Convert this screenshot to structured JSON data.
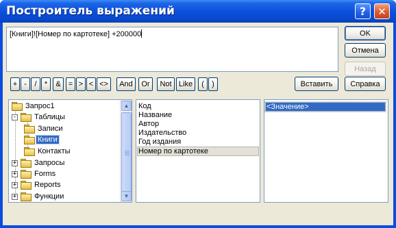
{
  "window": {
    "title": "Построитель выражений"
  },
  "expression": {
    "text": "[Книги]![Номер по картотеке] +200000"
  },
  "buttons": {
    "ok": "OK",
    "cancel": "Отмена",
    "back": "Назад",
    "insert": "Вставить",
    "help": "Справка"
  },
  "operators": [
    "+",
    "-",
    "/",
    "*",
    "&",
    "=",
    ">",
    "<",
    "<>",
    "And",
    "Or",
    "Not",
    "Like",
    "(",
    ")"
  ],
  "tree": [
    {
      "label": "Запрос1",
      "type": "folder"
    },
    {
      "label": "Таблицы",
      "type": "folder-open",
      "expander": "-"
    },
    {
      "label": "Записи",
      "type": "folder"
    },
    {
      "label": "Книги",
      "type": "folder-open",
      "selected": true
    },
    {
      "label": "Контакты",
      "type": "folder"
    },
    {
      "label": "Запросы",
      "type": "folder",
      "expander": "+"
    },
    {
      "label": "Forms",
      "type": "folder",
      "expander": "+"
    },
    {
      "label": "Reports",
      "type": "folder",
      "expander": "+"
    },
    {
      "label": "Функции",
      "type": "folder",
      "expander": "+"
    }
  ],
  "fields": [
    "Код",
    "Название",
    "Автор",
    "Издательство",
    "Год издания",
    "Номер по картотеке"
  ],
  "fields_selected_index": 5,
  "values": [
    "<Значение>"
  ],
  "icons": {
    "help": "question-icon",
    "close": "close-icon",
    "scroll_up": "scroll-up-arrow-icon",
    "scroll_down": "scroll-down-arrow-icon"
  },
  "colors": {
    "titlebar": "#0a4fdc",
    "face": "#ece9d8",
    "selection": "#316ac5"
  }
}
